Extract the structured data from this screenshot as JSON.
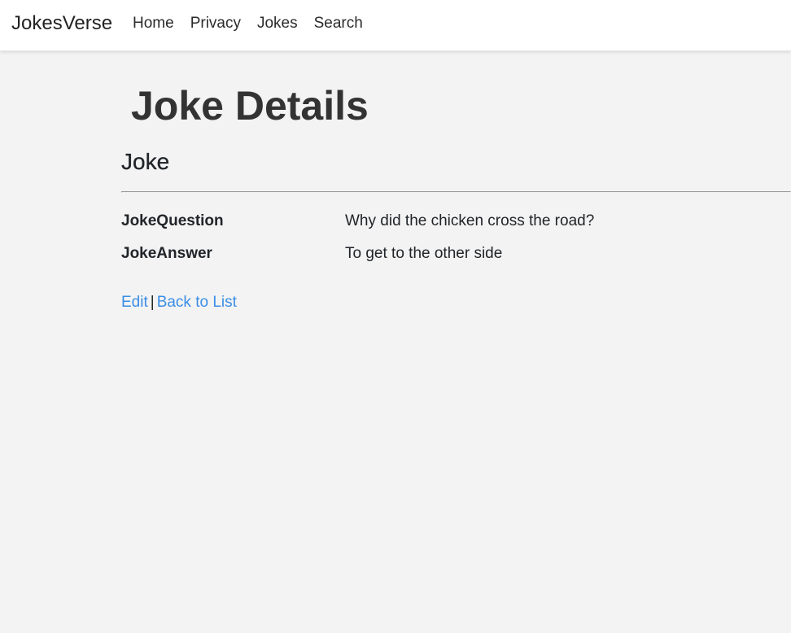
{
  "navbar": {
    "brand": "JokesVerse",
    "links": [
      "Home",
      "Privacy",
      "Jokes",
      "Search"
    ]
  },
  "page": {
    "title": "Joke Details",
    "section_title": "Joke"
  },
  "details": [
    {
      "term": "JokeQuestion",
      "value": "Why did the chicken cross the road?"
    },
    {
      "term": "JokeAnswer",
      "value": "To get to the other side"
    }
  ],
  "actions": {
    "edit_label": "Edit",
    "separator": "|",
    "back_label": "Back to List"
  },
  "colors": {
    "link": "#3a8ee6",
    "background": "#f3f3f3",
    "navbar": "#ffffff"
  }
}
